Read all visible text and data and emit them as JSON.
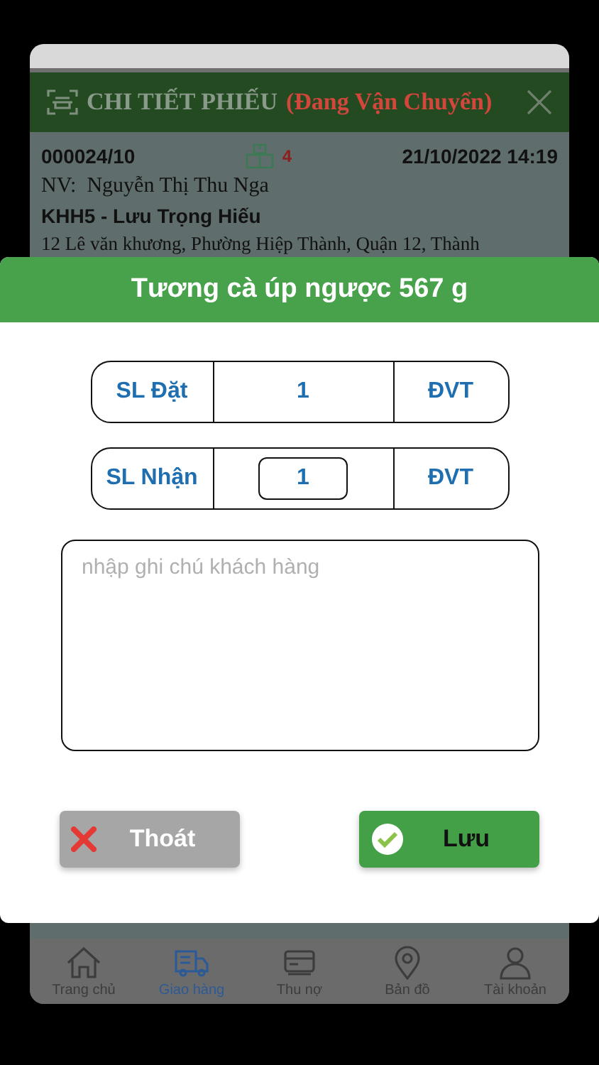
{
  "background": {
    "header": {
      "title": "CHI TIẾT PHIẾU",
      "status": "(Đang Vận Chuyển)"
    },
    "order": {
      "code": "000024/10",
      "package_count": "4",
      "datetime": "21/10/2022 14:19",
      "staff": "NV:  Nguyễn Thị Thu Nga",
      "customer": "KHH5 - Lưu Trọng Hiếu",
      "address": "12 Lê văn khương, Phường Hiệp Thành, Quận 12, Thành"
    },
    "tab_bar": [
      {
        "label": "Trang chủ",
        "kind": "home",
        "selected": false
      },
      {
        "label": "Giao hàng",
        "kind": "truck",
        "selected": true
      },
      {
        "label": "Thu nợ",
        "kind": "card",
        "selected": false
      },
      {
        "label": "Bản đồ",
        "kind": "pin",
        "selected": false
      },
      {
        "label": "Tài khoản",
        "kind": "user",
        "selected": false
      }
    ]
  },
  "dialog": {
    "title": "Tương cà úp ngược 567 g",
    "rows": [
      {
        "label": "SL Đặt",
        "value": "1",
        "unit": "ĐVT",
        "kind": "text"
      },
      {
        "label": "SL Nhận",
        "value": "1",
        "unit": "ĐVT",
        "kind": "input"
      }
    ],
    "note": {
      "placeholder": "nhập ghi chú khách hàng"
    },
    "buttons": [
      {
        "label": "Thoát",
        "kind": "cancel"
      },
      {
        "label": "Lưu",
        "kind": "save"
      }
    ]
  }
}
